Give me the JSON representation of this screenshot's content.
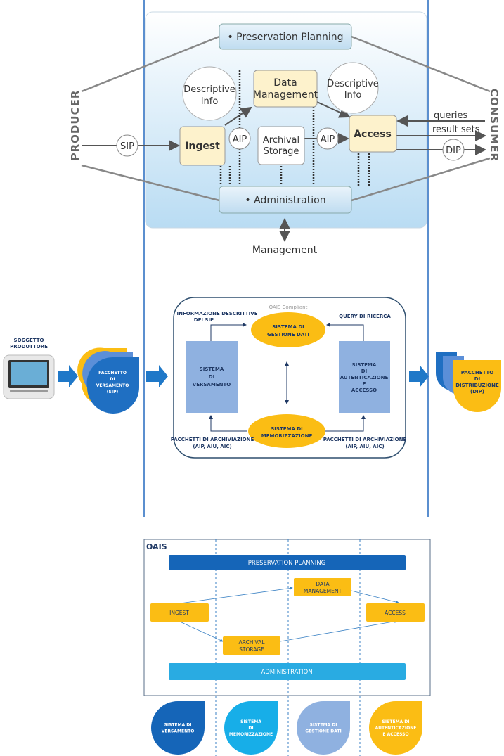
{
  "top": {
    "preservation_planning": "• Preservation Planning",
    "administration": "• Administration",
    "descriptive_info_left": [
      "Descriptive",
      "Info"
    ],
    "descriptive_info_right": [
      "Descriptive",
      "Info"
    ],
    "data_management": [
      "Data",
      "Management"
    ],
    "ingest": "Ingest",
    "archival_storage": [
      "Archival",
      "Storage"
    ],
    "access": "Access",
    "aip": "AIP",
    "sip": "SIP",
    "dip": "DIP",
    "producer": "PRODUCER",
    "consumer": "CONSUMER",
    "queries": "queries",
    "result_sets": "result sets",
    "management": "Management"
  },
  "middle": {
    "producer_label": [
      "SOGGETTO",
      "PRODUTTORE"
    ],
    "sip_package": [
      "PACCHETTO",
      "DI",
      "VERSAMENTO",
      "(SIP)"
    ],
    "dip_package": [
      "PACCHETTO",
      "DI",
      "DISTRIBUZIONE",
      "(DIP)"
    ],
    "oais_compliant": "OAIS Compliant",
    "gestione_dati": [
      "SISTEMA DI",
      "GESTIONE DATI"
    ],
    "memorizzazione": [
      "SISTEMA DI",
      "MEMORIZZAZIONE"
    ],
    "versamento": [
      "SISTEMA",
      "DI",
      "VERSAMENTO"
    ],
    "autenticazione": [
      "SISTEMA",
      "DI",
      "AUTENTICAZIONE",
      "E",
      "ACCESSO"
    ],
    "info_descrittive": [
      "INFORMAZIONE DESCRITTIVE",
      "DEI SIP"
    ],
    "query_ricerca": "QUERY DI RICERCA",
    "pacchetti_left": [
      "PACCHETTI DI ARCHIVIAZIONE",
      "(AIP, AIU, AIC)"
    ],
    "pacchetti_right": [
      "PACCHETTI DI ARCHIVIAZIONE",
      "(AIP, AIU, AIC)"
    ]
  },
  "bottom": {
    "oais": "OAIS",
    "preservation_planning": "PRESERVATION PLANNING",
    "data_management": [
      "DATA",
      "MANAGEMENT"
    ],
    "ingest": "INGEST",
    "access": "ACCESS",
    "archival_storage": [
      "ARCHIVAL",
      "STORAGE"
    ],
    "administration": "ADMINISTRATION",
    "drops": [
      {
        "lines": [
          "SISTEMA DI",
          "VERSAMENTO"
        ],
        "color": "#1565b8"
      },
      {
        "lines": [
          "SISTEMA",
          "DI",
          "MEMORIZZAZIONE"
        ],
        "color": "#17aee8"
      },
      {
        "lines": [
          "SISTEMA DI",
          "GESTIONE DATI"
        ],
        "color": "#8fb1e0"
      },
      {
        "lines": [
          "SISTEMA DI",
          "AUTENTICAZIONE",
          "E ACCESSO"
        ],
        "color": "#fbbd14"
      }
    ]
  },
  "colors": {
    "yellow": "#fbbd14",
    "blue_box": "#8fb1e0",
    "dark_blue": "#1565b8",
    "light_blue": "#29abe2",
    "divider": "#5b8fcf"
  }
}
